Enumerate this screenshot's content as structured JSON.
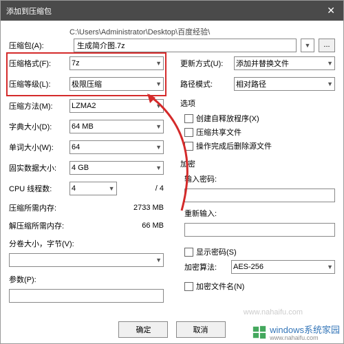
{
  "title": "添加到压缩包",
  "path": "C:\\Users\\Administrator\\Desktop\\百度经验\\",
  "archive": {
    "label": "压缩包(A):",
    "value": "生成简介图.7z",
    "browse": "..."
  },
  "left": {
    "format": {
      "label": "压缩格式(F):",
      "value": "7z"
    },
    "level": {
      "label": "压缩等级(L):",
      "value": "极限压缩"
    },
    "method": {
      "label": "压缩方法(M):",
      "value": "LZMA2"
    },
    "dict": {
      "label": "字典大小(D):",
      "value": "64 MB"
    },
    "word": {
      "label": "单词大小(W):",
      "value": "64"
    },
    "solid": {
      "label": "固实数据大小:",
      "value": "4 GB"
    },
    "threads": {
      "label": "CPU 线程数:",
      "value": "4",
      "max": "/ 4"
    },
    "memC": {
      "label": "压缩所需内存:",
      "value": "2733 MB"
    },
    "memD": {
      "label": "解压缩所需内存:",
      "value": "66 MB"
    },
    "split": {
      "label": "分卷大小，字节(V):",
      "value": ""
    },
    "params": {
      "label": "参数(P):",
      "value": ""
    }
  },
  "right": {
    "update": {
      "label": "更新方式(U):",
      "value": "添加并替换文件"
    },
    "pathmode": {
      "label": "路径模式:",
      "value": "相对路径"
    },
    "opts_title": "选项",
    "opts": {
      "sfx": "创建自释放程序(X)",
      "share": "压缩共享文件",
      "delete": "操作完成后删除源文件"
    },
    "enc_title": "加密",
    "pw_label": "输入密码:",
    "pw2_label": "重新输入:",
    "showpw": "显示密码(S)",
    "alg_label": "加密算法:",
    "alg_value": "AES-256",
    "encnames": "加密文件名(N)"
  },
  "buttons": {
    "ok": "确定",
    "cancel": "取消"
  },
  "watermark": {
    "brand": "windows系统家园",
    "url": "www.nahaifu.com",
    "faded": "www.nahaifu.com"
  }
}
